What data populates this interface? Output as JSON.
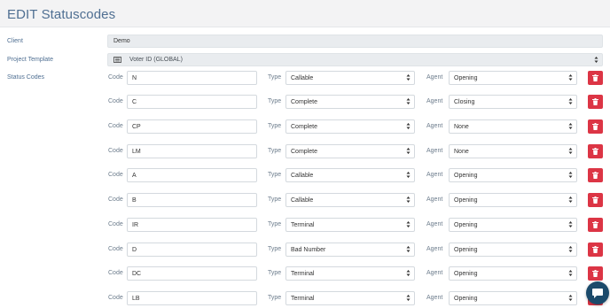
{
  "page": {
    "title": "EDIT Statuscodes"
  },
  "form": {
    "client_label": "Client",
    "client_value": "Demo",
    "template_label": "Project Template",
    "template_value": "Voter ID (GLOBAL)",
    "status_codes_label": "Status Codes"
  },
  "row_labels": {
    "code": "Code",
    "type": "Type",
    "agent": "Agent"
  },
  "status_codes": [
    {
      "code": "N",
      "type": "Callable",
      "agent": "Opening"
    },
    {
      "code": "C",
      "type": "Complete",
      "agent": "Closing"
    },
    {
      "code": "CP",
      "type": "Complete",
      "agent": "None"
    },
    {
      "code": "LM",
      "type": "Complete",
      "agent": "None"
    },
    {
      "code": "A",
      "type": "Callable",
      "agent": "Opening"
    },
    {
      "code": "B",
      "type": "Callable",
      "agent": "Opening"
    },
    {
      "code": "IR",
      "type": "Terminal",
      "agent": "Opening"
    },
    {
      "code": "D",
      "type": "Bad Number",
      "agent": "Opening"
    },
    {
      "code": "DC",
      "type": "Terminal",
      "agent": "Opening"
    },
    {
      "code": "LB",
      "type": "Terminal",
      "agent": "Opening"
    }
  ],
  "icons": {
    "delete": "trash-icon",
    "select": "select-arrows-icon",
    "template": "template-icon",
    "chat": "chat-icon"
  },
  "colors": {
    "accent": "#4f6f92",
    "danger": "#dc3545",
    "chat": "#1b4a6b"
  }
}
